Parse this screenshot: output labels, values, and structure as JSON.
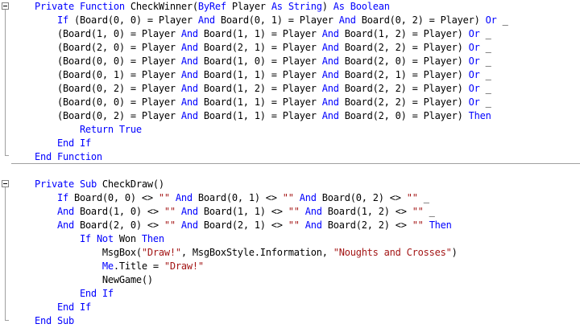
{
  "colors": {
    "keyword": "#0000ff",
    "string": "#a31515",
    "text": "#000000",
    "background": "#ffffff"
  },
  "code": {
    "lines": [
      [
        [
          "    ",
          "t"
        ],
        [
          "Private",
          "k"
        ],
        [
          " ",
          "t"
        ],
        [
          "Function",
          "k"
        ],
        [
          " CheckWinner(",
          "t"
        ],
        [
          "ByRef",
          "k"
        ],
        [
          " Player ",
          "t"
        ],
        [
          "As",
          "k"
        ],
        [
          " ",
          "t"
        ],
        [
          "String",
          "k"
        ],
        [
          ") ",
          "t"
        ],
        [
          "As",
          "k"
        ],
        [
          " ",
          "t"
        ],
        [
          "Boolean",
          "k"
        ]
      ],
      [
        [
          "        ",
          "t"
        ],
        [
          "If",
          "k"
        ],
        [
          " (Board(0, 0) = Player ",
          "t"
        ],
        [
          "And",
          "k"
        ],
        [
          " Board(0, 1) = Player ",
          "t"
        ],
        [
          "And",
          "k"
        ],
        [
          " Board(0, 2) = Player) ",
          "t"
        ],
        [
          "Or",
          "k"
        ],
        [
          " _",
          "t"
        ]
      ],
      [
        [
          "        (Board(1, 0) = Player ",
          "t"
        ],
        [
          "And",
          "k"
        ],
        [
          " Board(1, 1) = Player ",
          "t"
        ],
        [
          "And",
          "k"
        ],
        [
          " Board(1, 2) = Player) ",
          "t"
        ],
        [
          "Or",
          "k"
        ],
        [
          " _",
          "t"
        ]
      ],
      [
        [
          "        (Board(2, 0) = Player ",
          "t"
        ],
        [
          "And",
          "k"
        ],
        [
          " Board(2, 1) = Player ",
          "t"
        ],
        [
          "And",
          "k"
        ],
        [
          " Board(2, 2) = Player) ",
          "t"
        ],
        [
          "Or",
          "k"
        ],
        [
          " _",
          "t"
        ]
      ],
      [
        [
          "        (Board(0, 0) = Player ",
          "t"
        ],
        [
          "And",
          "k"
        ],
        [
          " Board(1, 0) = Player ",
          "t"
        ],
        [
          "And",
          "k"
        ],
        [
          " Board(2, 0) = Player) ",
          "t"
        ],
        [
          "Or",
          "k"
        ],
        [
          " _",
          "t"
        ]
      ],
      [
        [
          "        (Board(0, 1) = Player ",
          "t"
        ],
        [
          "And",
          "k"
        ],
        [
          " Board(1, 1) = Player ",
          "t"
        ],
        [
          "And",
          "k"
        ],
        [
          " Board(2, 1) = Player) ",
          "t"
        ],
        [
          "Or",
          "k"
        ],
        [
          " _",
          "t"
        ]
      ],
      [
        [
          "        (Board(0, 2) = Player ",
          "t"
        ],
        [
          "And",
          "k"
        ],
        [
          " Board(1, 2) = Player ",
          "t"
        ],
        [
          "And",
          "k"
        ],
        [
          " Board(2, 2) = Player) ",
          "t"
        ],
        [
          "Or",
          "k"
        ],
        [
          " _",
          "t"
        ]
      ],
      [
        [
          "        (Board(0, 0) = Player ",
          "t"
        ],
        [
          "And",
          "k"
        ],
        [
          " Board(1, 1) = Player ",
          "t"
        ],
        [
          "And",
          "k"
        ],
        [
          " Board(2, 2) = Player) ",
          "t"
        ],
        [
          "Or",
          "k"
        ],
        [
          " _",
          "t"
        ]
      ],
      [
        [
          "        (Board(0, 2) = Player ",
          "t"
        ],
        [
          "And",
          "k"
        ],
        [
          " Board(1, 1) = Player ",
          "t"
        ],
        [
          "And",
          "k"
        ],
        [
          " Board(2, 0) = Player) ",
          "t"
        ],
        [
          "Then",
          "k"
        ]
      ],
      [
        [
          "            ",
          "t"
        ],
        [
          "Return",
          "k"
        ],
        [
          " ",
          "t"
        ],
        [
          "True",
          "k"
        ]
      ],
      [
        [
          "        ",
          "t"
        ],
        [
          "End",
          "k"
        ],
        [
          " ",
          "t"
        ],
        [
          "If",
          "k"
        ]
      ],
      [
        [
          "    ",
          "t"
        ],
        [
          "End",
          "k"
        ],
        [
          " ",
          "t"
        ],
        [
          "Function",
          "k"
        ]
      ],
      [
        [
          "",
          "t"
        ]
      ],
      [
        [
          "    ",
          "t"
        ],
        [
          "Private",
          "k"
        ],
        [
          " ",
          "t"
        ],
        [
          "Sub",
          "k"
        ],
        [
          " CheckDraw()",
          "t"
        ]
      ],
      [
        [
          "        ",
          "t"
        ],
        [
          "If",
          "k"
        ],
        [
          " Board(0, 0) <> ",
          "t"
        ],
        [
          "\"\"",
          "s"
        ],
        [
          " ",
          "t"
        ],
        [
          "And",
          "k"
        ],
        [
          " Board(0, 1) <> ",
          "t"
        ],
        [
          "\"\"",
          "s"
        ],
        [
          " ",
          "t"
        ],
        [
          "And",
          "k"
        ],
        [
          " Board(0, 2) <> ",
          "t"
        ],
        [
          "\"\"",
          "s"
        ],
        [
          " _",
          "t"
        ]
      ],
      [
        [
          "        ",
          "t"
        ],
        [
          "And",
          "k"
        ],
        [
          " Board(1, 0) <> ",
          "t"
        ],
        [
          "\"\"",
          "s"
        ],
        [
          " ",
          "t"
        ],
        [
          "And",
          "k"
        ],
        [
          " Board(1, 1) <> ",
          "t"
        ],
        [
          "\"\"",
          "s"
        ],
        [
          " ",
          "t"
        ],
        [
          "And",
          "k"
        ],
        [
          " Board(1, 2) <> ",
          "t"
        ],
        [
          "\"\"",
          "s"
        ],
        [
          " _",
          "t"
        ]
      ],
      [
        [
          "        ",
          "t"
        ],
        [
          "And",
          "k"
        ],
        [
          " Board(2, 0) <> ",
          "t"
        ],
        [
          "\"\"",
          "s"
        ],
        [
          " ",
          "t"
        ],
        [
          "And",
          "k"
        ],
        [
          " Board(2, 1) <> ",
          "t"
        ],
        [
          "\"\"",
          "s"
        ],
        [
          " ",
          "t"
        ],
        [
          "And",
          "k"
        ],
        [
          " Board(2, 2) <> ",
          "t"
        ],
        [
          "\"\"",
          "s"
        ],
        [
          " ",
          "t"
        ],
        [
          "Then",
          "k"
        ]
      ],
      [
        [
          "            ",
          "t"
        ],
        [
          "If",
          "k"
        ],
        [
          " ",
          "t"
        ],
        [
          "Not",
          "k"
        ],
        [
          " Won ",
          "t"
        ],
        [
          "Then",
          "k"
        ]
      ],
      [
        [
          "                MsgBox(",
          "t"
        ],
        [
          "\"Draw!\"",
          "s"
        ],
        [
          ", MsgBoxStyle.Information, ",
          "t"
        ],
        [
          "\"Noughts and Crosses\"",
          "s"
        ],
        [
          ")",
          "t"
        ]
      ],
      [
        [
          "                ",
          "t"
        ],
        [
          "Me",
          "k"
        ],
        [
          ".Title = ",
          "t"
        ],
        [
          "\"Draw!\"",
          "s"
        ]
      ],
      [
        [
          "                NewGame()",
          "t"
        ]
      ],
      [
        [
          "            ",
          "t"
        ],
        [
          "End",
          "k"
        ],
        [
          " ",
          "t"
        ],
        [
          "If",
          "k"
        ]
      ],
      [
        [
          "        ",
          "t"
        ],
        [
          "End",
          "k"
        ],
        [
          " ",
          "t"
        ],
        [
          "If",
          "k"
        ]
      ],
      [
        [
          "    ",
          "t"
        ],
        [
          "End",
          "k"
        ],
        [
          " ",
          "t"
        ],
        [
          "Sub",
          "k"
        ]
      ]
    ]
  }
}
